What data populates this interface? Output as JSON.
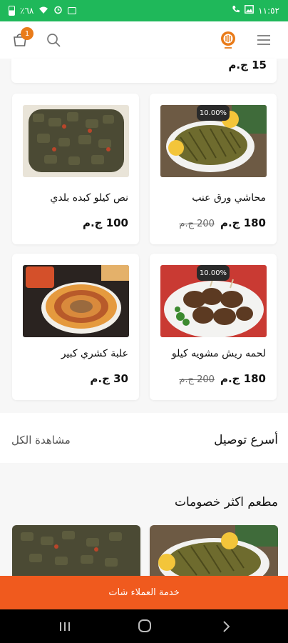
{
  "status_bar": {
    "time": "١١:٥٢",
    "battery": "٪٦٨",
    "colors": {
      "bg": "#1fb85a"
    }
  },
  "header": {
    "cart_count": "1",
    "icons": [
      "menu-icon",
      "logo-icon",
      "search-icon",
      "cart-icon"
    ],
    "accent": "#e97b19"
  },
  "prev_price": "15 ج.م",
  "products": [
    {
      "title": "محاشي ورق عنب",
      "price": "180 ج.م",
      "old_price": "200 ج.م",
      "discount": "10.00%"
    },
    {
      "title": "نص كيلو كبده بلدي",
      "price": "100 ج.م",
      "old_price": "",
      "discount": ""
    },
    {
      "title": "لحمه ريش مشويه كيلو",
      "price": "180 ج.م",
      "old_price": "200 ج.م",
      "discount": "10.00%"
    },
    {
      "title": "علبة كشري كبير",
      "price": "30 ج.م",
      "old_price": "",
      "discount": ""
    }
  ],
  "fastest_delivery": {
    "title": "أسرع توصيل",
    "see_all": "مشاهدة الكل"
  },
  "most_discounts": {
    "title": "مطعم اكثر خصومات"
  },
  "chat_button": "خدمة العملاء شات",
  "chat_color": "#f05a1e"
}
